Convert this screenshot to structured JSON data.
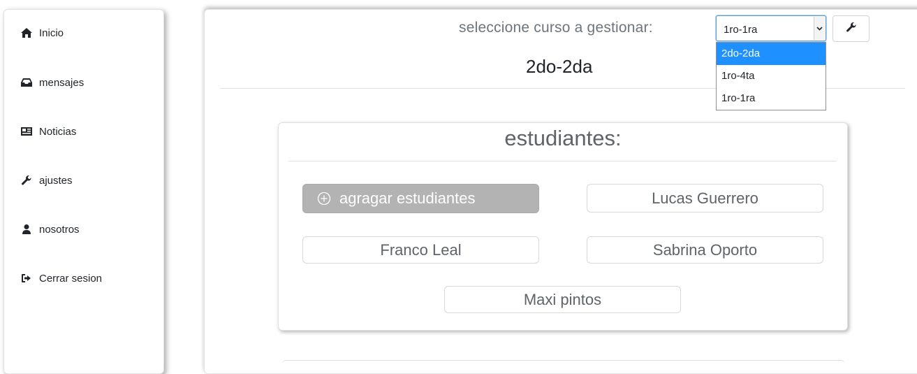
{
  "sidebar": {
    "items": [
      {
        "label": "Inicio",
        "icon": "home-icon"
      },
      {
        "label": "mensajes",
        "icon": "inbox-icon"
      },
      {
        "label": "Noticias",
        "icon": "newspaper-icon"
      },
      {
        "label": "ajustes",
        "icon": "wrench-icon"
      },
      {
        "label": "nosotros",
        "icon": "user-icon"
      },
      {
        "label": "Cerrar sesion",
        "icon": "sign-out-icon"
      }
    ]
  },
  "header": {
    "select_label": "seleccione curso a gestionar:",
    "select_value": "1ro-1ra",
    "options": [
      "2do-2da",
      "1ro-4ta",
      "1ro-1ra"
    ],
    "highlighted_option": "2do-2da",
    "settings_icon": "wrench-icon"
  },
  "course": {
    "title": "2do-2da"
  },
  "students": {
    "title": "estudiantes:",
    "add_label": "agragar estudiantes",
    "list": [
      "Lucas Guerrero",
      "Franco Leal",
      "Sabrina Oporto",
      "Maxi pintos"
    ]
  },
  "colors": {
    "highlight": "#1e90ff",
    "add_button": "#b3b3b3",
    "muted_text": "#5f6468"
  }
}
